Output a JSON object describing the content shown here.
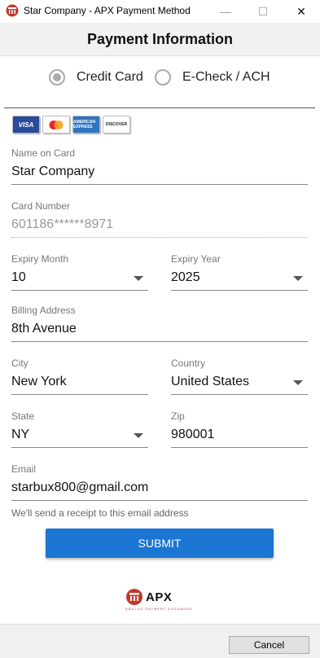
{
  "window": {
    "title": "Star Company - APX Payment Method",
    "min_glyph": "—",
    "max_glyph": "☐",
    "close_glyph": "✕"
  },
  "header": {
    "title": "Payment Information"
  },
  "payment_method": {
    "options": [
      {
        "label": "Credit Card",
        "selected": true
      },
      {
        "label": "E-Check / ACH",
        "selected": false
      }
    ]
  },
  "card_logos": [
    {
      "name": "visa-logo",
      "text": "VISA"
    },
    {
      "name": "mastercard-logo",
      "text": ""
    },
    {
      "name": "amex-logo",
      "text": "AMERICAN EXPRESS"
    },
    {
      "name": "discover-logo",
      "text": "DISCOVER"
    }
  ],
  "form": {
    "name_on_card": {
      "label": "Name on Card",
      "value": "Star Company"
    },
    "card_number": {
      "label": "Card Number",
      "value": "601186******8971"
    },
    "expiry_month": {
      "label": "Expiry Month",
      "value": "10"
    },
    "expiry_year": {
      "label": "Expiry Year",
      "value": "2025"
    },
    "billing_address": {
      "label": "Billing Address",
      "value": "8th Avenue"
    },
    "city": {
      "label": "City",
      "value": "New York"
    },
    "country": {
      "label": "Country",
      "value": "United States"
    },
    "state": {
      "label": "State",
      "value": "NY"
    },
    "zip": {
      "label": "Zip",
      "value": "980001"
    },
    "email": {
      "label": "Email",
      "value": "starbux800@gmail.com",
      "helper": "We'll send a receipt to this email address"
    }
  },
  "submit_label": "SUBMIT",
  "logo": {
    "text": "APX",
    "subtitle": "ABACUS PAYMENT EXCHANGE"
  },
  "cancel_label": "Cancel",
  "colors": {
    "accent": "#1a76d2",
    "brand_red": "#c0392b"
  }
}
